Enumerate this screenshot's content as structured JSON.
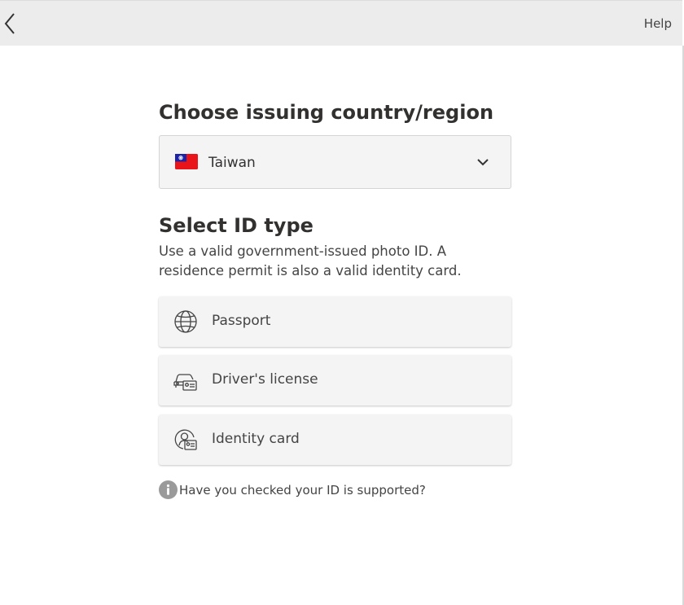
{
  "header": {
    "help_label": "Help"
  },
  "country": {
    "heading": "Choose issuing country/region",
    "selected": "Taiwan"
  },
  "id_type": {
    "heading": "Select ID type",
    "description": "Use a valid government-issued photo ID. A residence permit is also a valid identity card.",
    "options": [
      {
        "label": "Passport",
        "icon": "globe-icon"
      },
      {
        "label": "Driver's license",
        "icon": "car-id-icon"
      },
      {
        "label": "Identity card",
        "icon": "person-id-icon"
      }
    ]
  },
  "support": {
    "link_text": "Have you checked your ID is supported?"
  },
  "colors": {
    "topbar": "#ececec",
    "panel": "#f4f4f4",
    "text": "#323130",
    "flag_red": "#e8141a",
    "flag_blue": "#1c23a8"
  }
}
